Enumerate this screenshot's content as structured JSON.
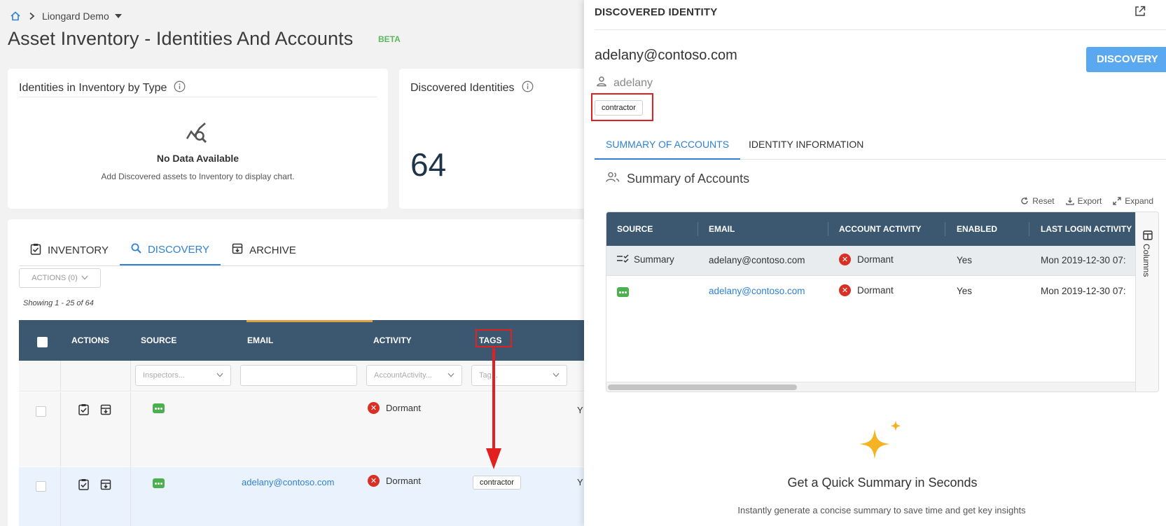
{
  "breadcrumb": {
    "org": "Liongard Demo"
  },
  "page": {
    "title": "Asset Inventory - Identities And Accounts",
    "badge": "BETA"
  },
  "cards": {
    "type_card": {
      "title": "Identities in Inventory by Type",
      "nodata_title": "No Data Available",
      "nodata_sub": "Add Discovered assets to Inventory to display chart."
    },
    "discovered_card": {
      "title": "Discovered Identities",
      "count": "64"
    }
  },
  "tabs": [
    {
      "label": "INVENTORY",
      "icon": "clipboard-check-icon"
    },
    {
      "label": "DISCOVERY",
      "icon": "search-icon",
      "active": true
    },
    {
      "label": "ARCHIVE",
      "icon": "archive-icon"
    }
  ],
  "toolbar": {
    "actions_label": "ACTIONS (0)",
    "showing": "Showing 1 - 25 of 64"
  },
  "grid": {
    "columns": [
      "ACTIONS",
      "SOURCE",
      "EMAIL",
      "ACTIVITY",
      "TAGS"
    ],
    "filters": {
      "source": "Inspectors...",
      "email": "",
      "activity": "AccountActivity...",
      "tags": "Tag..."
    },
    "rows": [
      {
        "email": "",
        "activity": "Dormant",
        "tag": "",
        "trailing": "Y"
      },
      {
        "email": "adelany@contoso.com",
        "activity": "Dormant",
        "tag": "contractor",
        "trailing": "Y"
      }
    ]
  },
  "drawer": {
    "title": "DISCOVERED IDENTITY",
    "email": "adelany@contoso.com",
    "username": "adelany",
    "tag": "contractor",
    "discovery_button": "DISCOVERY",
    "tabs": [
      "SUMMARY OF ACCOUNTS",
      "IDENTITY INFORMATION"
    ],
    "section_title": "Summary of Accounts",
    "tools": {
      "reset": "Reset",
      "export": "Export",
      "expand": "Expand"
    },
    "grid": {
      "columns": [
        "SOURCE",
        "EMAIL",
        "ACCOUNT ACTIVITY",
        "ENABLED",
        "LAST LOGIN ACTIVITY"
      ],
      "side_label": "Columns",
      "rows": [
        {
          "source": "Summary",
          "email": "adelany@contoso.com",
          "activity": "Dormant",
          "enabled": "Yes",
          "last_login": "Mon 2019-12-30 07:"
        },
        {
          "source": "",
          "email": "adelany@contoso.com",
          "activity": "Dormant",
          "enabled": "Yes",
          "last_login": "Mon 2019-12-30 07:"
        }
      ]
    },
    "quick_summary": {
      "title": "Get a Quick Summary in Seconds",
      "subtitle": "Instantly generate a concise summary to save time and get key insights"
    }
  },
  "colors": {
    "accent": "#2f80d6",
    "header": "#3c5770",
    "danger": "#d93025",
    "success": "#4caf50",
    "highlight": "#e32020"
  }
}
